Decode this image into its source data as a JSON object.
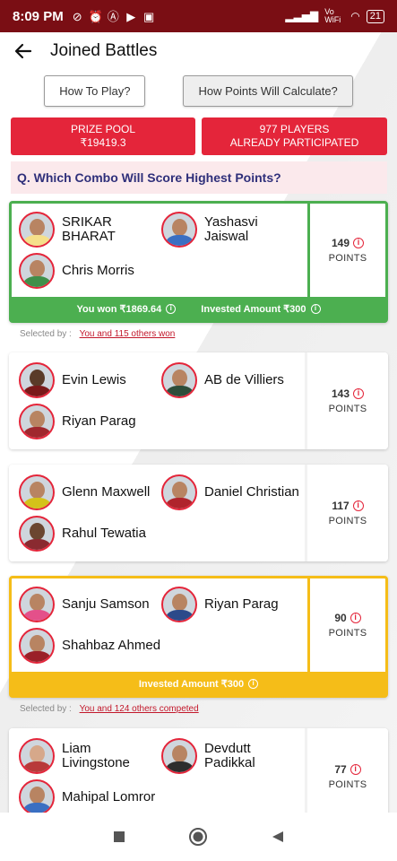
{
  "status": {
    "time": "8:09 PM",
    "network": "Vo WiFi",
    "battery": "21"
  },
  "header": {
    "title": "Joined Battles"
  },
  "buttons": {
    "how_to_play": "How To Play?",
    "how_points": "How Points Will Calculate?"
  },
  "stats": {
    "prize_label": "PRIZE POOL",
    "prize_value": "₹19419.3",
    "players_line1": "977 PLAYERS",
    "players_line2": "ALREADY PARTICIPATED"
  },
  "question": "Q. Which Combo Will Score Highest Points?",
  "points_label": "POINTS",
  "selected_prefix": "Selected by :",
  "cards": [
    {
      "players": [
        "SRIKAR BHARAT",
        "Yashasvi Jaiswal",
        "Chris Morris"
      ],
      "points": "149",
      "footer_won": "You won ₹1869.64",
      "footer_invested": "Invested Amount ₹300",
      "selected_by": "You and 115 others won"
    },
    {
      "players": [
        "Evin Lewis",
        "AB de Villiers",
        "Riyan Parag"
      ],
      "points": "143"
    },
    {
      "players": [
        "Glenn Maxwell",
        "Daniel Christian",
        "Rahul Tewatia"
      ],
      "points": "117"
    },
    {
      "players": [
        "Sanju Samson",
        "Riyan Parag",
        "Shahbaz Ahmed"
      ],
      "points": "90",
      "footer_invested": "Invested Amount ₹300",
      "selected_by": "You and 124 others competed"
    },
    {
      "players": [
        "Liam Livingstone",
        "Devdutt Padikkal",
        "Mahipal Lomror"
      ],
      "points": "77"
    }
  ],
  "colors": {
    "status_bar": "#7a0e14",
    "accent_red": "#e4253a",
    "win_green": "#4caf50",
    "gold": "#f5bd18",
    "question_text": "#2f2f7a"
  },
  "nav": [
    "square-icon",
    "circle-icon",
    "triangle-back-icon"
  ]
}
